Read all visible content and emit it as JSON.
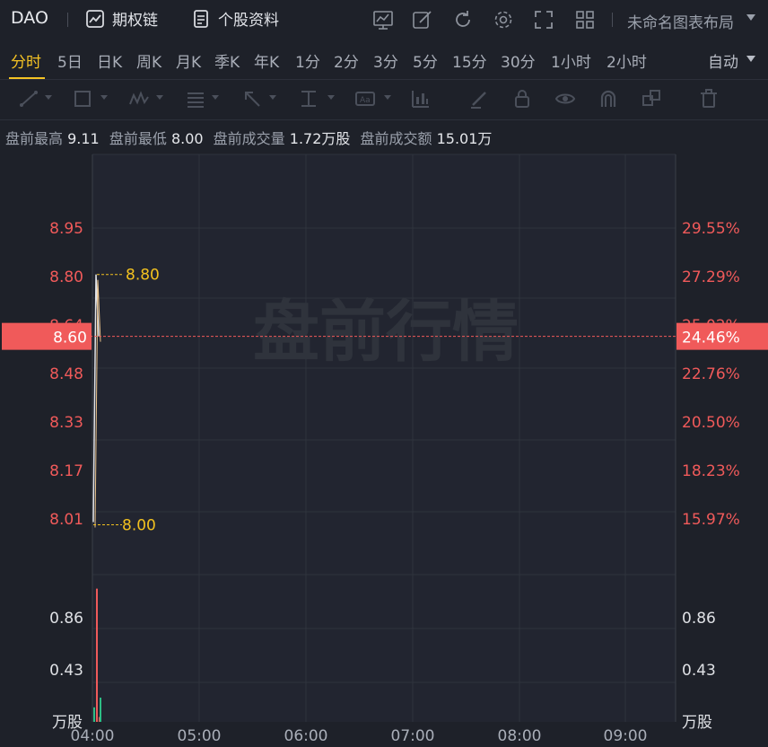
{
  "header": {
    "ticker": "DAO",
    "options_chain": "期权链",
    "stock_profile": "个股资料",
    "layout_name": "未命名图表布局"
  },
  "periods": [
    "分时",
    "5日",
    "日K",
    "周K",
    "月K",
    "季K",
    "年K",
    "1分",
    "2分",
    "3分",
    "5分",
    "15分",
    "30分",
    "1小时",
    "2小时"
  ],
  "active_period": "分时",
  "auto_scale": "自动",
  "stats": [
    {
      "label": "盘前最高",
      "value": "9.11"
    },
    {
      "label": "盘前最低",
      "value": "8.00"
    },
    {
      "label": "盘前成交量",
      "value": "1.72万股"
    },
    {
      "label": "盘前成交额",
      "value": "15.01万"
    }
  ],
  "chart_data": {
    "type": "line",
    "watermark": "盘前行情",
    "price_axis_left": [
      "8.95",
      "8.80",
      "8.64",
      "8.48",
      "8.33",
      "8.17",
      "8.01"
    ],
    "price_axis_right": [
      "29.55%",
      "27.29%",
      "25.02%",
      "22.76%",
      "20.50%",
      "18.23%",
      "15.97%"
    ],
    "price_range": [
      8.01,
      8.95
    ],
    "current_price": {
      "value": "8.60",
      "change_pct": "24.46%",
      "color": "#f05a5a"
    },
    "high_marker": "8.80",
    "low_marker": "8.00",
    "x_ticks": [
      "04:00",
      "05:00",
      "06:00",
      "07:00",
      "08:00",
      "09:00"
    ],
    "price_series": [
      {
        "t": "04:00",
        "price": 8.0
      },
      {
        "t": "04:01",
        "price": 8.8
      },
      {
        "t": "04:02",
        "price": 8.6
      }
    ],
    "volume_axis": [
      "0.86",
      "0.43"
    ],
    "volume_unit": "万股",
    "volume_series": [
      {
        "t": "04:00",
        "volume": 0.12,
        "dir": "down"
      },
      {
        "t": "04:01",
        "volume": 1.1,
        "dir": "up"
      },
      {
        "t": "04:02",
        "volume": 0.04,
        "dir": "up"
      },
      {
        "t": "04:03",
        "volume": 0.2,
        "dir": "flat"
      }
    ],
    "colors": {
      "up": "#f05a5a",
      "down": "#2ebd85",
      "flat": "#2ebd85",
      "line": "#e0e2e6",
      "marker": "#f2c11f",
      "axis_text": "#f05a5a"
    }
  }
}
